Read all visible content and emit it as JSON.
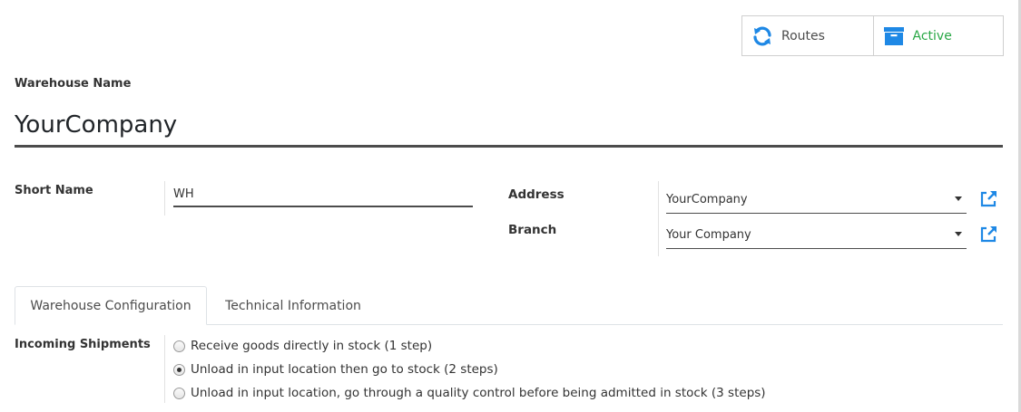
{
  "smart_buttons": {
    "routes_label": "Routes",
    "active_label": "Active",
    "routes_icon": "refresh-icon",
    "active_icon": "archive-icon",
    "icon_color": "#1e88e5",
    "active_color": "#28a745"
  },
  "form": {
    "name_label": "Warehouse Name",
    "name_value": "YourCompany",
    "short_name_label": "Short Name",
    "short_name_value": "WH",
    "address_label": "Address",
    "address_value": "YourCompany",
    "branch_label": "Branch",
    "branch_value": "Your Company"
  },
  "tabs": {
    "config_label": "Warehouse Configuration",
    "tech_label": "Technical Information"
  },
  "incoming": {
    "label": "Incoming Shipments",
    "options": [
      {
        "label": "Receive goods directly in stock (1 step)",
        "checked": false
      },
      {
        "label": "Unload in input location then go to stock (2 steps)",
        "checked": true
      },
      {
        "label": "Unload in input location, go through a quality control before being admitted in stock (3 steps)",
        "checked": false
      }
    ]
  }
}
